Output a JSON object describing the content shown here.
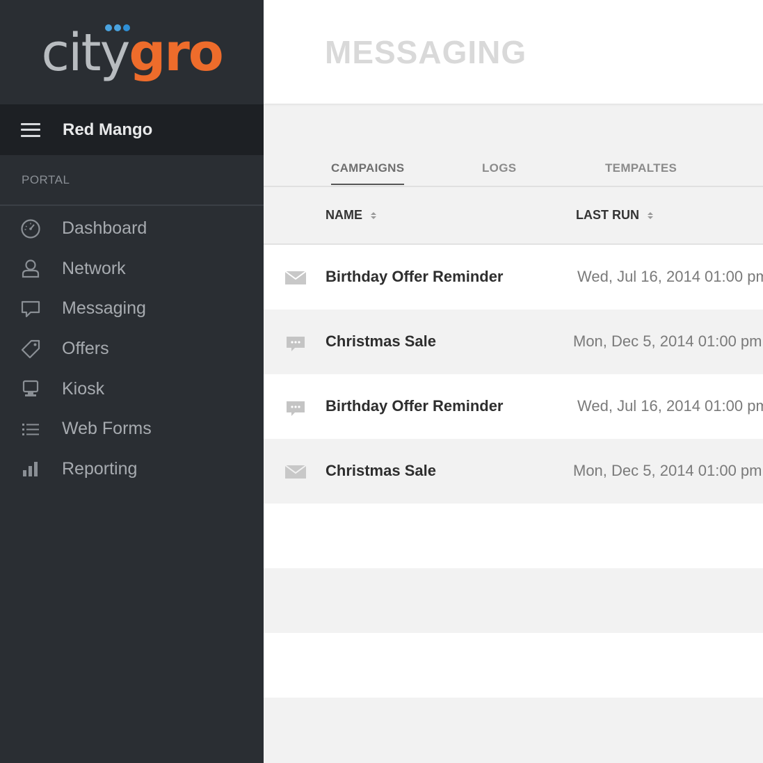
{
  "brand": {
    "logo_left": "city",
    "logo_right": "gro"
  },
  "account": {
    "name": "Red Mango"
  },
  "sidebar": {
    "section_label": "PORTAL",
    "items": [
      {
        "label": "Dashboard",
        "icon": "dashboard-gauge-icon"
      },
      {
        "label": "Network",
        "icon": "user-icon"
      },
      {
        "label": "Messaging",
        "icon": "speech-bubble-icon"
      },
      {
        "label": "Offers",
        "icon": "tag-icon"
      },
      {
        "label": "Kiosk",
        "icon": "monitor-icon"
      },
      {
        "label": "Web Forms",
        "icon": "list-icon"
      },
      {
        "label": "Reporting",
        "icon": "bar-chart-icon"
      }
    ]
  },
  "header": {
    "title": "MESSAGING"
  },
  "tabs": [
    {
      "label": "CAMPAIGNS",
      "active": true
    },
    {
      "label": "LOGS",
      "active": false
    },
    {
      "label": "TEMPALTES",
      "active": false
    }
  ],
  "table": {
    "columns": [
      "NAME",
      "LAST RUN"
    ],
    "rows": [
      {
        "type": "email-icon",
        "name": "Birthday Offer Reminder",
        "last_run": "Wed, Jul 16, 2014 01:00 pm"
      },
      {
        "type": "sms-icon",
        "name": "Christmas Sale",
        "last_run": "Mon, Dec 5, 2014 01:00 pm"
      },
      {
        "type": "sms-icon",
        "name": "Birthday Offer Reminder",
        "last_run": "Wed, Jul 16, 2014 01:00 pm"
      },
      {
        "type": "email-icon",
        "name": "Christmas Sale",
        "last_run": "Mon, Dec 5, 2014 01:00 pm"
      }
    ]
  },
  "colors": {
    "sidebar_bg": "#2a2e33",
    "account_bar_bg": "#1d2024",
    "brand_orange": "#ee6c2b",
    "brand_blue": "#4aa3df",
    "icon_gray": "#c4c4c4"
  }
}
